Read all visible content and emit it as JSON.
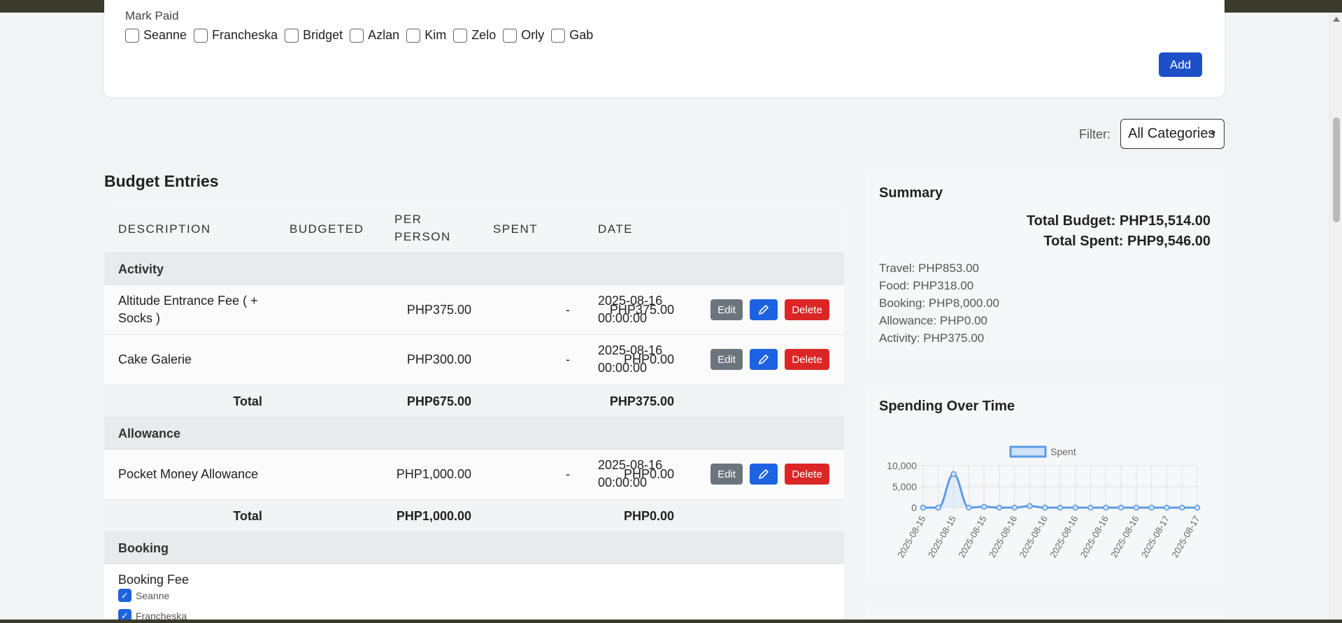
{
  "form": {
    "mark_paid_label": "Mark Paid",
    "people": [
      "Seanne",
      "Francheska",
      "Bridget",
      "Azlan",
      "Kim",
      "Zelo",
      "Orly",
      "Gab"
    ],
    "add_label": "Add"
  },
  "filter": {
    "label": "Filter:",
    "selected": "All Categories"
  },
  "entries": {
    "title": "Budget Entries",
    "headers": {
      "description": "DESCRIPTION",
      "budgeted": "BUDGETED",
      "per_person_1": "PER",
      "per_person_2": "PERSON",
      "spent": "SPENT",
      "date": "DATE"
    },
    "buttons": {
      "edit": "Edit",
      "delete": "Delete",
      "pen_icon": "pencil-icon"
    },
    "groups": [
      {
        "name": "Activity",
        "items": [
          {
            "desc_1": "Altitude Entrance Fee ( +",
            "desc_2": "Socks )",
            "budgeted": "PHP375.00",
            "per_person": "-",
            "spent": "PHP375.00",
            "date_1": "2025-08-16",
            "date_2": "00:00:00"
          },
          {
            "desc_1": "Cake Galerie",
            "desc_2": "",
            "budgeted": "PHP300.00",
            "per_person": "-",
            "spent": "PHP0.00",
            "date_1": "2025-08-16",
            "date_2": "00:00:00"
          }
        ],
        "total_label": "Total",
        "total_budgeted": "PHP675.00",
        "total_spent": "PHP375.00"
      },
      {
        "name": "Allowance",
        "items": [
          {
            "desc_1": "Pocket Money Allowance",
            "desc_2": "",
            "budgeted": "PHP1,000.00",
            "per_person": "-",
            "spent": "PHP0.00",
            "date_1": "2025-08-16",
            "date_2": "00:00:00"
          }
        ],
        "total_label": "Total",
        "total_budgeted": "PHP1,000.00",
        "total_spent": "PHP0.00"
      },
      {
        "name": "Booking",
        "items": [
          {
            "desc_1": "Booking Fee",
            "paid": [
              "Seanne",
              "Francheska"
            ]
          }
        ]
      }
    ]
  },
  "summary": {
    "title": "Summary",
    "total_budget": "Total Budget: PHP15,514.00",
    "total_spent": "Total Spent: PHP9,546.00",
    "categories": [
      "Travel: PHP853.00",
      "Food: PHP318.00",
      "Booking: PHP8,000.00",
      "Allowance: PHP0.00",
      "Activity: PHP375.00"
    ]
  },
  "chart_section": {
    "title": "Spending Over Time"
  },
  "chart_data": {
    "type": "line",
    "title": "",
    "xlabel": "",
    "ylabel": "",
    "series": [
      {
        "name": "Spent",
        "values": [
          0,
          0,
          8000,
          0,
          200,
          0,
          0,
          375,
          0,
          0,
          0,
          0,
          0,
          0,
          0,
          0,
          0,
          0,
          0
        ]
      }
    ],
    "x": [
      "2025-08-15",
      "2025-08-15",
      "2025-08-15",
      "2025-08-15",
      "2025-08-15",
      "2025-08-16",
      "2025-08-16",
      "2025-08-16",
      "2025-08-16",
      "2025-08-16",
      "2025-08-16",
      "2025-08-16",
      "2025-08-16",
      "2025-08-16",
      "2025-08-16",
      "2025-08-17",
      "2025-08-17",
      "2025-08-17",
      "2025-08-17"
    ],
    "x_tick_labels": [
      "2025-08-15",
      "2025-08-15",
      "2025-08-15",
      "2025-08-16",
      "2025-08-16",
      "2025-08-16",
      "2025-08-16",
      "2025-08-16",
      "2025-08-17",
      "2025-08-17"
    ],
    "y_ticks": [
      "10,000",
      "5,000",
      "0"
    ],
    "ylim": [
      0,
      10000
    ],
    "grid": true,
    "legend": "top-center",
    "colors": {
      "line": "#5b9be6",
      "fill": "#cfe2f8"
    }
  }
}
